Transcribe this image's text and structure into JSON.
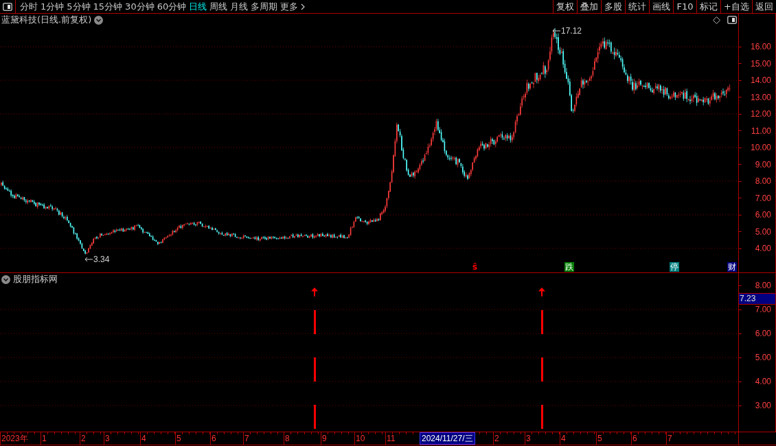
{
  "toolbar": {
    "periods": [
      {
        "label": "分时",
        "kind": "period",
        "selected": false
      },
      {
        "label": "1分钟",
        "kind": "period",
        "selected": false
      },
      {
        "label": "5分钟",
        "kind": "period",
        "selected": false
      },
      {
        "label": "15分钟",
        "kind": "period",
        "selected": false
      },
      {
        "label": "30分钟",
        "kind": "period",
        "selected": false
      },
      {
        "label": "60分钟",
        "kind": "period",
        "selected": false
      },
      {
        "label": "日线",
        "kind": "period",
        "selected": true
      },
      {
        "label": "周线",
        "kind": "period",
        "selected": false
      },
      {
        "label": "月线",
        "kind": "period",
        "selected": false
      },
      {
        "label": "多周期",
        "kind": "period",
        "selected": false
      },
      {
        "label": "更多",
        "kind": "menu",
        "selected": false
      }
    ],
    "actions": [
      "复权",
      "叠加",
      "多股",
      "统计",
      "画线",
      "F10",
      "标记",
      "+自选",
      "返回"
    ]
  },
  "main_chart": {
    "title": "蓝黛科技(日线.前复权)",
    "price_axis": [
      "16.00",
      "15.00",
      "14.00",
      "13.00",
      "12.00",
      "11.00",
      "10.00",
      "9.00",
      "8.00",
      "7.00",
      "6.00",
      "5.00",
      "4.00"
    ],
    "high_label": "17.12",
    "low_label": "3.34"
  },
  "event_markers": [
    {
      "kind": "signal",
      "label": "ŝ",
      "color": "#ff0000"
    },
    {
      "kind": "badge",
      "label": "跌",
      "color": "#008000"
    },
    {
      "kind": "badge",
      "label": "停",
      "color": "#008080"
    },
    {
      "kind": "badge",
      "label": "财",
      "color": "#000080"
    }
  ],
  "indicator": {
    "title": "股朋指标网",
    "axis": [
      "8.00",
      "7.00",
      "6.00",
      "5.00",
      "4.00",
      "3.00"
    ],
    "cursor_value": "7.23"
  },
  "time_axis": {
    "labels": [
      "2023年",
      "1",
      "2",
      "3",
      "4",
      "5",
      "6",
      "7",
      "8",
      "9",
      "10",
      "11",
      "2",
      "3",
      "4",
      "5",
      "6",
      "7"
    ],
    "cursor_date": "2024/11/27/三"
  }
}
